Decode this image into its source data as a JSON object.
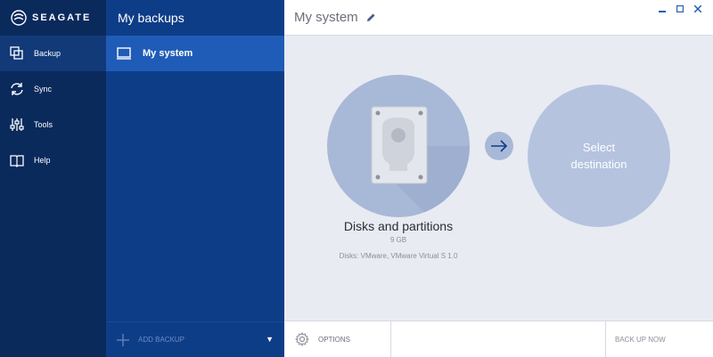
{
  "brand": {
    "logo_text": "SEAGATE"
  },
  "nav": {
    "items": [
      {
        "label": "Backup",
        "icon": "backup-icon",
        "active": true
      },
      {
        "label": "Sync",
        "icon": "sync-icon"
      },
      {
        "label": "Tools",
        "icon": "tools-icon"
      },
      {
        "label": "Help",
        "icon": "help-book-icon"
      }
    ]
  },
  "backups": {
    "title": "My backups",
    "items": [
      {
        "label": "My system",
        "icon": "monitor-icon"
      }
    ],
    "add_label": "ADD BACKUP"
  },
  "main": {
    "title": "My system",
    "source": {
      "label": "Disks and partitions",
      "size": "9 GB",
      "disks": "Disks: VMware, VMware Virtual S 1.0"
    },
    "destination": {
      "line1": "Select",
      "line2": "destination"
    }
  },
  "bottom": {
    "options_label": "OPTIONS",
    "backup_now_label": "BACK UP NOW"
  },
  "colors": {
    "nav_bg": "#0a2a5c",
    "backups_bg": "#0e3d88",
    "active_item": "#1f5cb8",
    "circle": "#a8b8d7",
    "canvas_bg": "#e8ebf2"
  }
}
